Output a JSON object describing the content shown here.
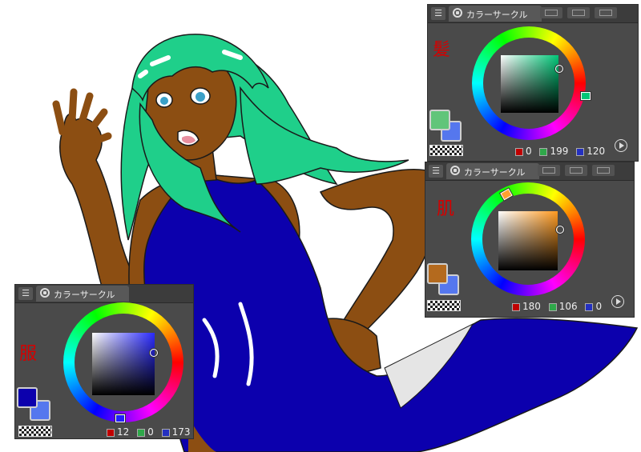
{
  "panels": {
    "hair": {
      "tab_label": "カラーサークル",
      "label": "髪",
      "rgb": {
        "r": "0",
        "g": "199",
        "b": "120"
      },
      "main_color": "#61c57a",
      "sub_color": "#5577ee",
      "sv_hue": "#00c778"
    },
    "skin": {
      "tab_label": "カラーサークル",
      "label": "肌",
      "rgb": {
        "r": "180",
        "g": "106",
        "b": "0"
      },
      "main_color": "#b46a1e",
      "sub_color": "#5577ee",
      "sv_hue": "#ff9a20"
    },
    "clothes": {
      "tab_label": "カラーサークル",
      "label": "服",
      "rgb": {
        "r": "12",
        "g": "0",
        "b": "173"
      },
      "main_color": "#0c00ad",
      "sub_color": "#5577ee",
      "sv_hue": "#2a2aff"
    }
  },
  "colors": {
    "hair": "#1fcf8a",
    "skin": "#8c4e12",
    "dress": "#0c00ad",
    "outline": "#1a1a1a"
  }
}
